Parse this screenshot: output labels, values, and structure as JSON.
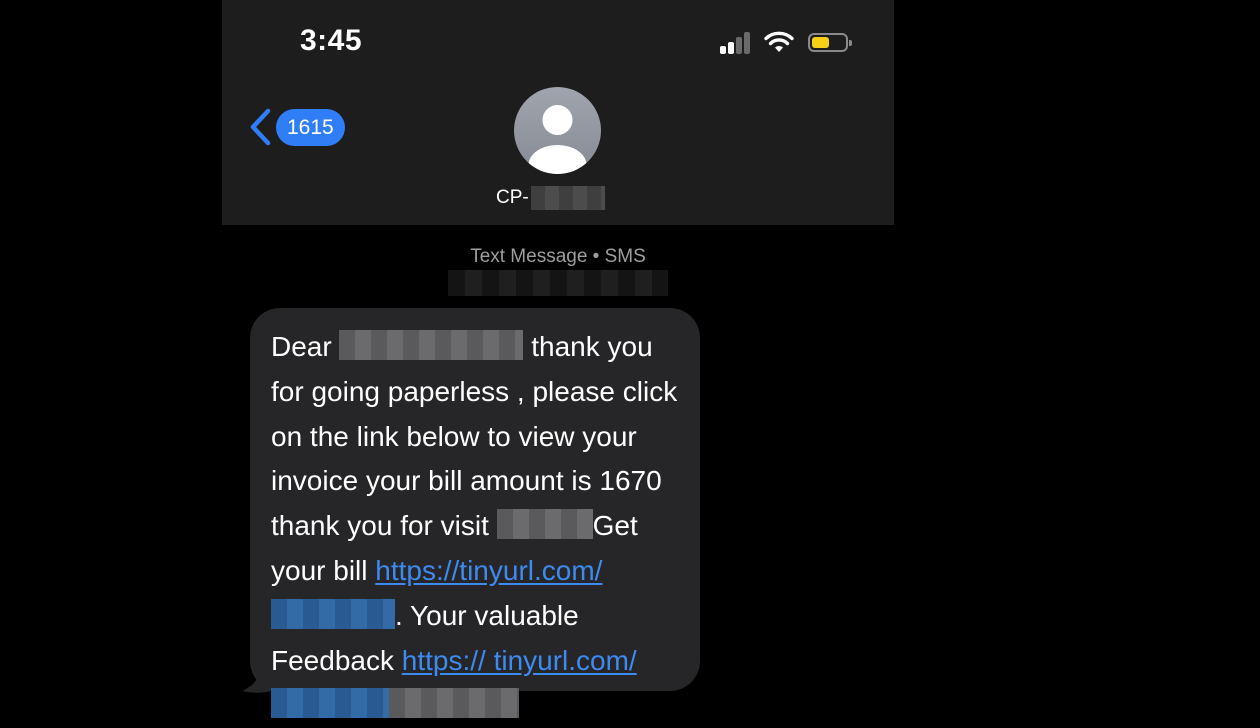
{
  "status_bar": {
    "time": "3:45"
  },
  "nav": {
    "back_count": "1615",
    "contact_prefix": "CP-"
  },
  "meta": {
    "service": "Text Message • SMS"
  },
  "message": {
    "t1": "Dear ",
    "t2": " thank you for going paperless , please click on the link below to view your invoice your bill amount is 1670 thank you for visit ",
    "t3": "Get your bill ",
    "link1": "https://tinyurl.com/",
    "t4": ". Your valuable Feedback ",
    "link2": "https:// tinyurl.com/"
  },
  "colors": {
    "accent": "#2f7ef6",
    "link": "#3d8af0",
    "battery": "#f5d017",
    "bubble": "#262628",
    "header": "#1d1d1d"
  }
}
